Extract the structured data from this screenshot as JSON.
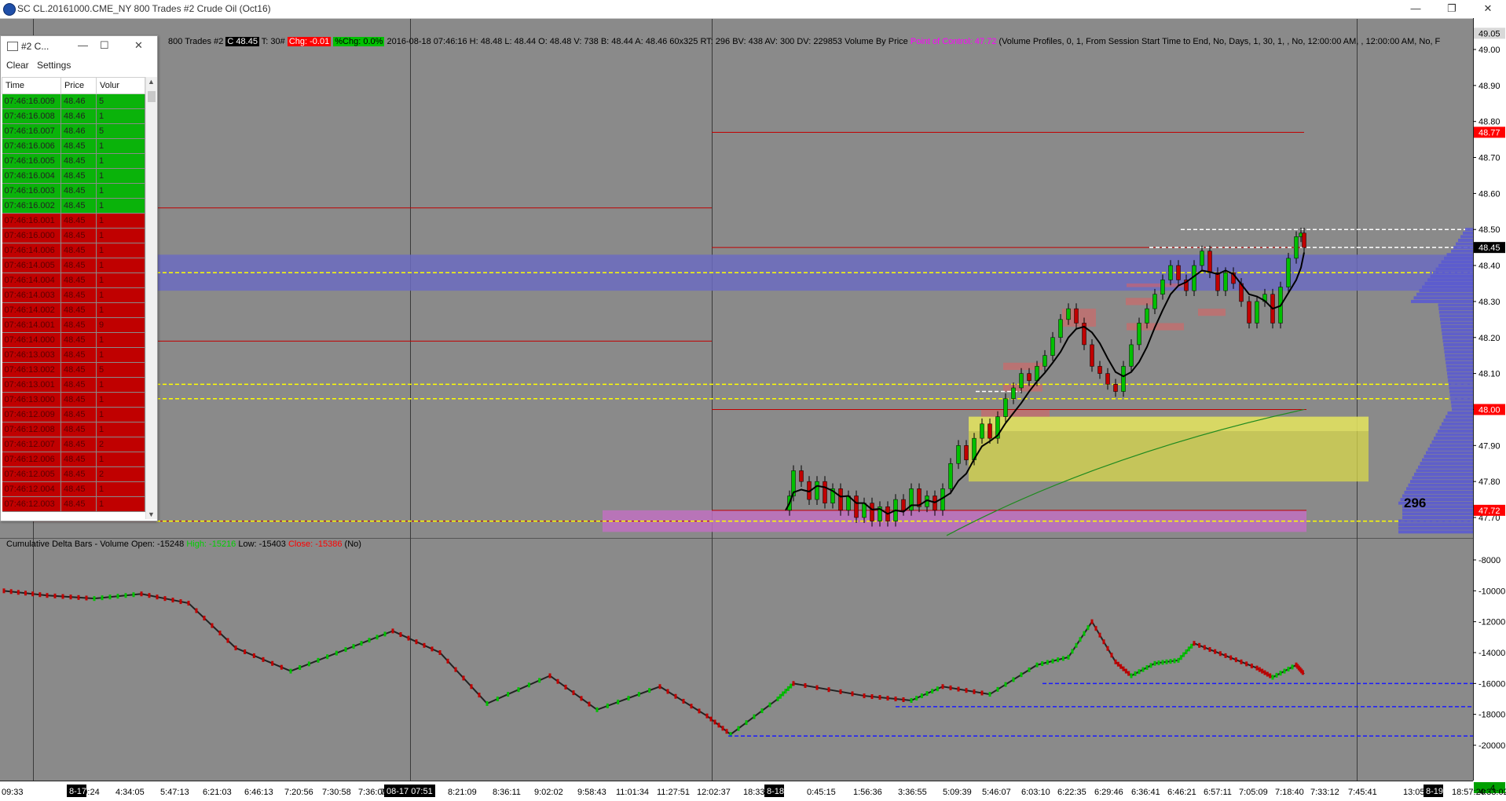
{
  "window": {
    "title": "SC CL.20161000.CME_NY  800 Trades  #2  Crude Oil (Oct16)",
    "minimize": "—",
    "restore": "❐",
    "close": "✕"
  },
  "chart_header": {
    "prefix": "800 Trades  #2",
    "last_box": "C 48.45",
    "t_label": "T: 30#",
    "chg_box": "Chg: -0.01",
    "pchg_box": "%Chg: 0.0%",
    "details": "2016-08-18  07:46:16  H: 48.48  L: 48.44  O: 48.48  V: 738  B: 48.44  A: 48.46  60x325  RT: 296  BV: 438  AV: 300  DV: 229853  Volume By Price",
    "poc": "Point of Control: 47.72",
    "profile_text": "(Volume Profiles, 0, 1, From Session Start Time to End, No, Days, 1, 30, 1, , No, 12:00:00 AM, , 12:00:00 AM, No, F"
  },
  "lower_header": {
    "name": "Cumulative Delta Bars - Volume",
    "open": "Open: -15248",
    "high": "High: -15216",
    "low": "Low: -15403",
    "close": "Close: -15386",
    "no": "(No)"
  },
  "price_axis": {
    "labels": [
      "49.00",
      "48.90",
      "48.80",
      "48.70",
      "48.60",
      "48.50",
      "48.40",
      "48.30",
      "48.20",
      "48.10",
      "48.00",
      "47.90",
      "47.80",
      "47.70"
    ],
    "badges": [
      {
        "text": "48.77",
        "value": 48.77,
        "bg": "#ff0000",
        "fg": "#ffffff"
      },
      {
        "text": "48.45",
        "value": 48.45,
        "bg": "#000000",
        "fg": "#ffffff"
      },
      {
        "text": "48.00",
        "value": 48.0,
        "bg": "#ff0000",
        "fg": "#ffffff"
      },
      {
        "text": "47.72",
        "value": 47.72,
        "bg": "#ff0000",
        "fg": "#ffffff"
      },
      {
        "text": "49.05",
        "value": 49.045,
        "bg": "#d8d8d8",
        "fg": "#000000"
      }
    ]
  },
  "delta_axis": {
    "labels": [
      "-8000",
      "-10000",
      "-12000",
      "-14000",
      "-16000",
      "-18000",
      "-20000"
    ],
    "badge": "4"
  },
  "annotation_296": "296",
  "time_axis": {
    "labels": [
      "09:33",
      "1:49:24",
      "4:34:05",
      "5:47:13",
      "6:21:03",
      "6:46:13",
      "7:20:56",
      "7:30:58",
      "7:36:09",
      "7",
      "8:21:09",
      "8:36:11",
      "9:02:02",
      "9:58:43",
      "11:01:34",
      "11:27:51",
      "12:02:37",
      "18:33:45",
      "0:45:15",
      "1:56:36",
      "3:36:55",
      "5:09:39",
      "5:46:07",
      "6:03:10",
      "6:22:35",
      "6:29:46",
      "6:36:41",
      "6:46:21",
      "6:57:11",
      "7:05:09",
      "7:18:40",
      "7:33:12",
      "7:45:41",
      "13:05:31",
      "18:57:20",
      "4:33:02"
    ],
    "date_badges": [
      "8-17",
      "08-17  07:51",
      "8-18",
      "8-19"
    ]
  },
  "time_sales": {
    "title": "#2 C...",
    "menu": [
      "Clear",
      "Settings"
    ],
    "columns": [
      "Time",
      "Price",
      "Volur"
    ],
    "colors": {
      "buy": "#0ab30a",
      "sell": "#c00000"
    },
    "rows": [
      {
        "time": "07:46:16.009",
        "price": "48.46",
        "vol": "5",
        "side": "buy"
      },
      {
        "time": "07:46:16.008",
        "price": "48.46",
        "vol": "1",
        "side": "buy"
      },
      {
        "time": "07:46:16.007",
        "price": "48.46",
        "vol": "5",
        "side": "buy"
      },
      {
        "time": "07:46:16.006",
        "price": "48.45",
        "vol": "1",
        "side": "buy"
      },
      {
        "time": "07:46:16.005",
        "price": "48.45",
        "vol": "1",
        "side": "buy"
      },
      {
        "time": "07:46:16.004",
        "price": "48.45",
        "vol": "1",
        "side": "buy"
      },
      {
        "time": "07:46:16.003",
        "price": "48.45",
        "vol": "1",
        "side": "buy"
      },
      {
        "time": "07:46:16.002",
        "price": "48.45",
        "vol": "1",
        "side": "buy"
      },
      {
        "time": "07:46:16.001",
        "price": "48.45",
        "vol": "1",
        "side": "sell"
      },
      {
        "time": "07:46:16.000",
        "price": "48.45",
        "vol": "1",
        "side": "sell"
      },
      {
        "time": "07:46:14.006",
        "price": "48.45",
        "vol": "1",
        "side": "sell"
      },
      {
        "time": "07:46:14.005",
        "price": "48.45",
        "vol": "1",
        "side": "sell"
      },
      {
        "time": "07:46:14.004",
        "price": "48.45",
        "vol": "1",
        "side": "sell"
      },
      {
        "time": "07:46:14.003",
        "price": "48.45",
        "vol": "1",
        "side": "sell"
      },
      {
        "time": "07:46:14.002",
        "price": "48.45",
        "vol": "1",
        "side": "sell"
      },
      {
        "time": "07:46:14.001",
        "price": "48.45",
        "vol": "9",
        "side": "sell"
      },
      {
        "time": "07:46:14.000",
        "price": "48.45",
        "vol": "1",
        "side": "sell"
      },
      {
        "time": "07:46:13.003",
        "price": "48.45",
        "vol": "1",
        "side": "sell"
      },
      {
        "time": "07:46:13.002",
        "price": "48.45",
        "vol": "5",
        "side": "sell"
      },
      {
        "time": "07:46:13.001",
        "price": "48.45",
        "vol": "1",
        "side": "sell"
      },
      {
        "time": "07:46:13.000",
        "price": "48.45",
        "vol": "1",
        "side": "sell"
      },
      {
        "time": "07:46:12.009",
        "price": "48.45",
        "vol": "1",
        "side": "sell"
      },
      {
        "time": "07:46:12.008",
        "price": "48.45",
        "vol": "1",
        "side": "sell"
      },
      {
        "time": "07:46:12.007",
        "price": "48.45",
        "vol": "2",
        "side": "sell"
      },
      {
        "time": "07:46:12.006",
        "price": "48.45",
        "vol": "1",
        "side": "sell"
      },
      {
        "time": "07:46:12.005",
        "price": "48.45",
        "vol": "2",
        "side": "sell"
      },
      {
        "time": "07:46:12.004",
        "price": "48.45",
        "vol": "1",
        "side": "sell"
      },
      {
        "time": "07:46:12.003",
        "price": "48.45",
        "vol": "1",
        "side": "sell"
      }
    ]
  }
}
